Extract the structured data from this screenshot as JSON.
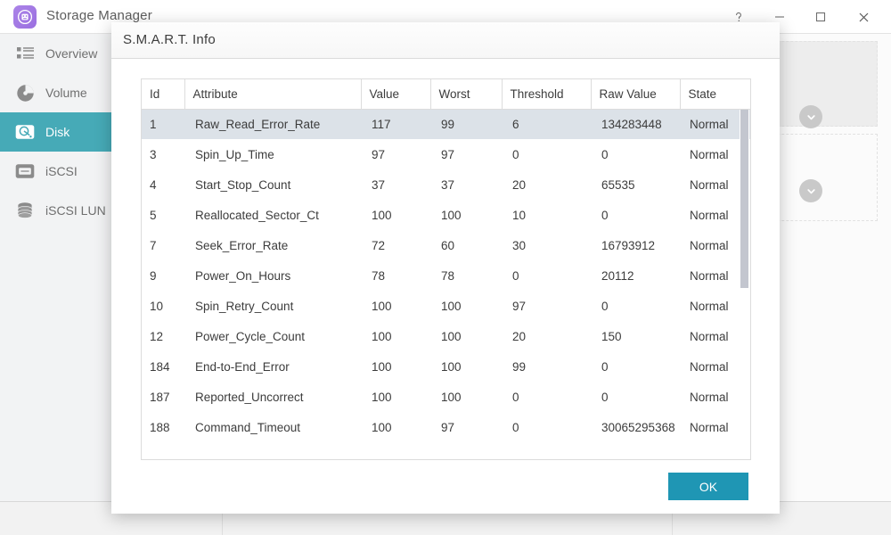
{
  "window": {
    "title": "Storage Manager",
    "app_icon": "storage-manager-icon",
    "controls": [
      {
        "name": "help-button",
        "glyph": "?"
      },
      {
        "name": "minimize-button",
        "glyph": "—"
      },
      {
        "name": "maximize-button",
        "glyph": "□"
      },
      {
        "name": "close-button",
        "glyph": "✕"
      }
    ]
  },
  "sidebar": {
    "items": [
      {
        "label": "Overview",
        "icon": "list-grid-icon",
        "selected": false
      },
      {
        "label": "Volume",
        "icon": "pie-disk-icon",
        "selected": false
      },
      {
        "label": "Disk",
        "icon": "hard-disk-icon",
        "selected": true
      },
      {
        "label": "iSCSI",
        "icon": "iscsi-icon",
        "selected": false
      },
      {
        "label": "iSCSI LUN",
        "icon": "database-icon",
        "selected": false
      }
    ]
  },
  "dialog": {
    "title": "S.M.A.R.T. Info",
    "ok_label": "OK",
    "table": {
      "columns": [
        "Id",
        "Attribute",
        "Value",
        "Worst",
        "Threshold",
        "Raw Value",
        "State"
      ],
      "rows": [
        {
          "id": "1",
          "attribute": "Raw_Read_Error_Rate",
          "value": "117",
          "worst": "99",
          "threshold": "6",
          "raw": "134283448",
          "state": "Normal",
          "selected": true
        },
        {
          "id": "3",
          "attribute": "Spin_Up_Time",
          "value": "97",
          "worst": "97",
          "threshold": "0",
          "raw": "0",
          "state": "Normal",
          "selected": false
        },
        {
          "id": "4",
          "attribute": "Start_Stop_Count",
          "value": "37",
          "worst": "37",
          "threshold": "20",
          "raw": "65535",
          "state": "Normal",
          "selected": false
        },
        {
          "id": "5",
          "attribute": "Reallocated_Sector_Ct",
          "value": "100",
          "worst": "100",
          "threshold": "10",
          "raw": "0",
          "state": "Normal",
          "selected": false
        },
        {
          "id": "7",
          "attribute": "Seek_Error_Rate",
          "value": "72",
          "worst": "60",
          "threshold": "30",
          "raw": "16793912",
          "state": "Normal",
          "selected": false
        },
        {
          "id": "9",
          "attribute": "Power_On_Hours",
          "value": "78",
          "worst": "78",
          "threshold": "0",
          "raw": "20112",
          "state": "Normal",
          "selected": false
        },
        {
          "id": "10",
          "attribute": "Spin_Retry_Count",
          "value": "100",
          "worst": "100",
          "threshold": "97",
          "raw": "0",
          "state": "Normal",
          "selected": false
        },
        {
          "id": "12",
          "attribute": "Power_Cycle_Count",
          "value": "100",
          "worst": "100",
          "threshold": "20",
          "raw": "150",
          "state": "Normal",
          "selected": false
        },
        {
          "id": "184",
          "attribute": "End-to-End_Error",
          "value": "100",
          "worst": "100",
          "threshold": "99",
          "raw": "0",
          "state": "Normal",
          "selected": false
        },
        {
          "id": "187",
          "attribute": "Reported_Uncorrect",
          "value": "100",
          "worst": "100",
          "threshold": "0",
          "raw": "0",
          "state": "Normal",
          "selected": false
        },
        {
          "id": "188",
          "attribute": "Command_Timeout",
          "value": "100",
          "worst": "97",
          "threshold": "0",
          "raw": "30065295368",
          "state": "Normal",
          "selected": false
        }
      ]
    }
  },
  "colors": {
    "accent_teal": "#46aab7",
    "ok_button": "#1f96b4",
    "selected_row": "#dce2e8",
    "app_icon_purple": "#9b6fe0"
  }
}
